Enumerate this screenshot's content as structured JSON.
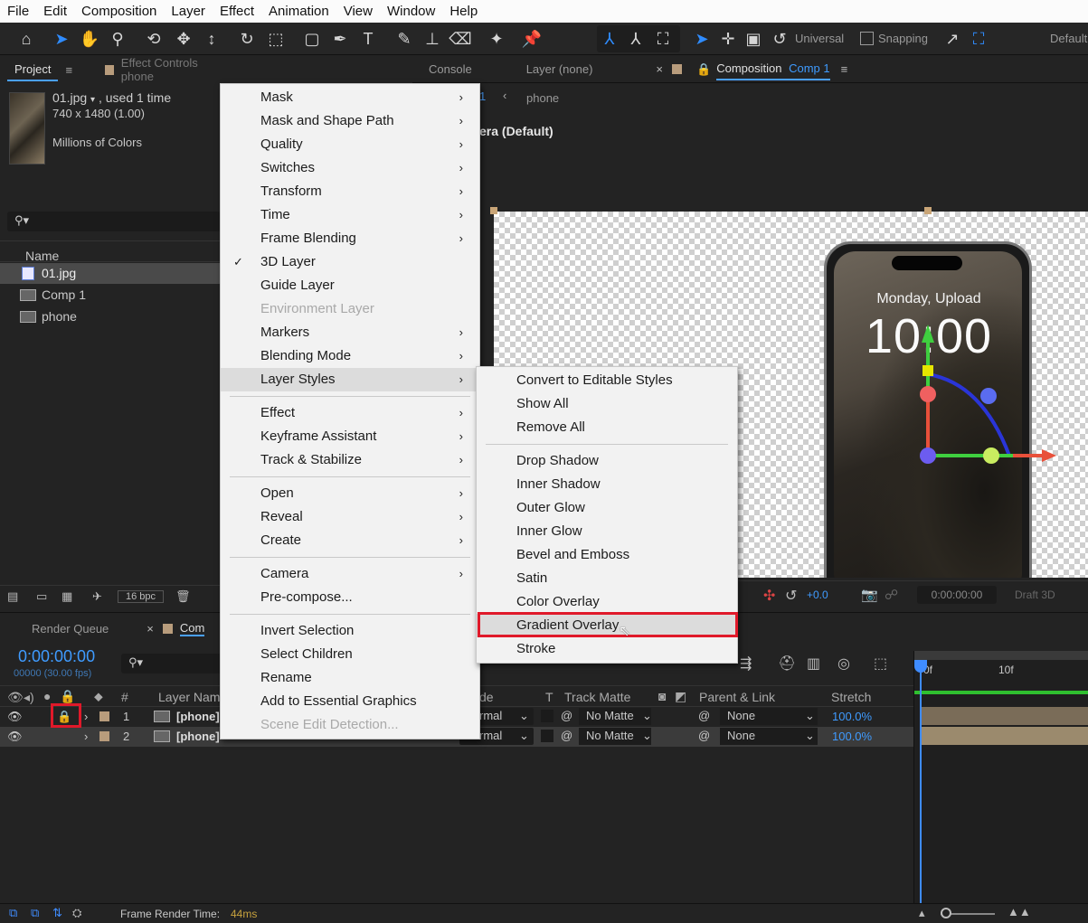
{
  "menubar": [
    "File",
    "Edit",
    "Composition",
    "Layer",
    "Effect",
    "Animation",
    "View",
    "Window",
    "Help"
  ],
  "toolbar": {
    "axis_mode": "Universal",
    "snapping": "Snapping",
    "workspace": "Default"
  },
  "project": {
    "tab_label": "Project",
    "effect_controls": "Effect Controls phone",
    "file_name": "01.jpg",
    "usage": ", used 1 time",
    "dimensions": "740 x 1480 (1.00)",
    "colors": "Millions of Colors",
    "column_name": "Name",
    "items": [
      "01.jpg",
      "Comp 1",
      "phone"
    ],
    "bpc": "16 bpc"
  },
  "viewer": {
    "tabs": [
      "Console",
      "Layer (none)"
    ],
    "comp_tab_prefix": "Composition",
    "comp_tab_name": "Comp 1",
    "breadcrumb_fragment": "1",
    "breadcrumb_layer": "phone",
    "camera_fragment": "era (Default)",
    "phone_date": "Monday, Upload",
    "phone_time": "10:00",
    "exposure": "+0.0",
    "timecode": "0:00:00:00",
    "renderer": "Draft 3D"
  },
  "context_menu": {
    "items": [
      {
        "label": "Mask",
        "sub": true
      },
      {
        "label": "Mask and Shape Path",
        "sub": true
      },
      {
        "label": "Quality",
        "sub": true
      },
      {
        "label": "Switches",
        "sub": true
      },
      {
        "label": "Transform",
        "sub": true
      },
      {
        "label": "Time",
        "sub": true
      },
      {
        "label": "Frame Blending",
        "sub": true
      },
      {
        "label": "3D Layer",
        "checked": true
      },
      {
        "label": "Guide Layer"
      },
      {
        "label": "Environment Layer",
        "disabled": true
      },
      {
        "label": "Markers",
        "sub": true
      },
      {
        "label": "Blending Mode",
        "sub": true
      },
      {
        "label": "Layer Styles",
        "sub": true,
        "highlighted": true
      },
      {
        "sep": true
      },
      {
        "label": "Effect",
        "sub": true
      },
      {
        "label": "Keyframe Assistant",
        "sub": true
      },
      {
        "label": "Track & Stabilize",
        "sub": true
      },
      {
        "sep": true
      },
      {
        "label": "Open",
        "sub": true
      },
      {
        "label": "Reveal",
        "sub": true
      },
      {
        "label": "Create",
        "sub": true
      },
      {
        "sep": true
      },
      {
        "label": "Camera",
        "sub": true
      },
      {
        "label": "Pre-compose..."
      },
      {
        "sep": true
      },
      {
        "label": "Invert Selection"
      },
      {
        "label": "Select Children"
      },
      {
        "label": "Rename"
      },
      {
        "label": "Add to Essential Graphics"
      },
      {
        "label": "Scene Edit Detection...",
        "disabled": true
      }
    ]
  },
  "layer_styles_submenu": {
    "items": [
      {
        "label": "Convert to Editable Styles"
      },
      {
        "label": "Show All"
      },
      {
        "label": "Remove All"
      },
      {
        "sep": true
      },
      {
        "label": "Drop Shadow"
      },
      {
        "label": "Inner Shadow"
      },
      {
        "label": "Outer Glow"
      },
      {
        "label": "Inner Glow"
      },
      {
        "label": "Bevel and Emboss"
      },
      {
        "label": "Satin"
      },
      {
        "label": "Color Overlay"
      },
      {
        "label": "Gradient Overlay",
        "highlighted": true
      },
      {
        "label": "Stroke"
      }
    ]
  },
  "timeline": {
    "render_queue": "Render Queue",
    "comp_tab_fragment": "Com",
    "timecode": "0:00:00:00",
    "frames_fps": "00000 (30.00 fps)",
    "col_hash": "#",
    "col_layer_name": "Layer Nam",
    "col_mode_fragment": "de",
    "col_t": "T",
    "col_track_matte": "Track Matte",
    "col_parent": "Parent & Link",
    "col_stretch": "Stretch",
    "ruler": [
      "0f",
      "10f"
    ],
    "layers": [
      {
        "num": "1",
        "name": "[phone]",
        "mode": "rmal",
        "matte": "No Matte",
        "parent": "None",
        "stretch": "100.0%"
      },
      {
        "num": "2",
        "name": "[phone]",
        "mode": "rmal",
        "matte": "No Matte",
        "parent": "None",
        "stretch": "100.0%"
      }
    ],
    "frame_render_label": "Frame Render Time:",
    "frame_render_value": "44ms"
  },
  "colors": {
    "accent": "#2f8cff",
    "highlight_box": "#e0192a",
    "swatch": "#b89c7c"
  }
}
